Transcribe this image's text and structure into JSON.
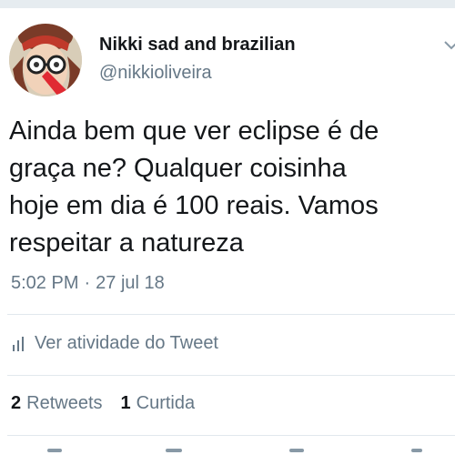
{
  "author": {
    "display_name": "Nikki sad and brazilian",
    "handle": "@nikkioliveira"
  },
  "tweet": {
    "lines": [
      "Ainda bem que ver eclipse é de",
      "graça ne? Qualquer coisinha",
      "hoje em dia é 100 reais. Vamos",
      "respeitar a natureza"
    ],
    "time": "5:02 PM",
    "separator": "·",
    "date": "27 jul 18"
  },
  "activity": {
    "label": "Ver atividade do Tweet"
  },
  "stats": {
    "retweets": {
      "count": "2",
      "label": "Retweets"
    },
    "likes": {
      "count": "1",
      "label": "Curtida"
    }
  },
  "icons": {
    "menu": "chevron-down-icon",
    "activity": "bar-chart-icon"
  },
  "colors": {
    "text": "#14171a",
    "secondary": "#657786",
    "divider": "#e1e8ed"
  }
}
